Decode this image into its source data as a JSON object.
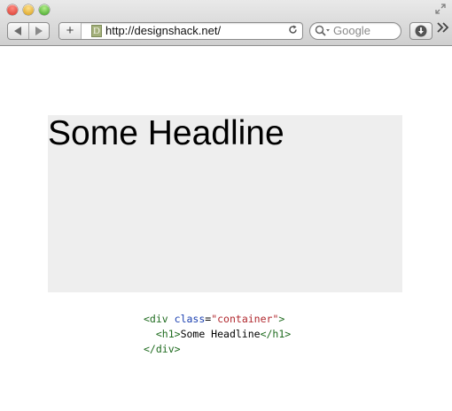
{
  "browser": {
    "url": "http://designshack.net/",
    "search_placeholder": "Google",
    "favicon_letter": "D",
    "add_label": "+"
  },
  "page": {
    "headline": "Some Headline",
    "code": {
      "line1_open": "<div",
      "line1_attr": "class",
      "line1_eq": "=",
      "line1_val": "\"container\"",
      "line1_close": ">",
      "line2_open": "<h1>",
      "line2_text": "Some Headline",
      "line2_close": "</h1>",
      "line3": "</div>"
    }
  },
  "colors": {
    "container_bg": "#eeeeee",
    "tag": "#1f6b1f",
    "attr": "#1a3fb0",
    "value": "#b0272d"
  },
  "icons": [
    "close-light-icon",
    "minimize-light-icon",
    "zoom-light-icon",
    "fullscreen-icon",
    "back-icon",
    "forward-icon",
    "reload-icon",
    "search-icon",
    "download-icon",
    "overflow-chevron-icon"
  ]
}
